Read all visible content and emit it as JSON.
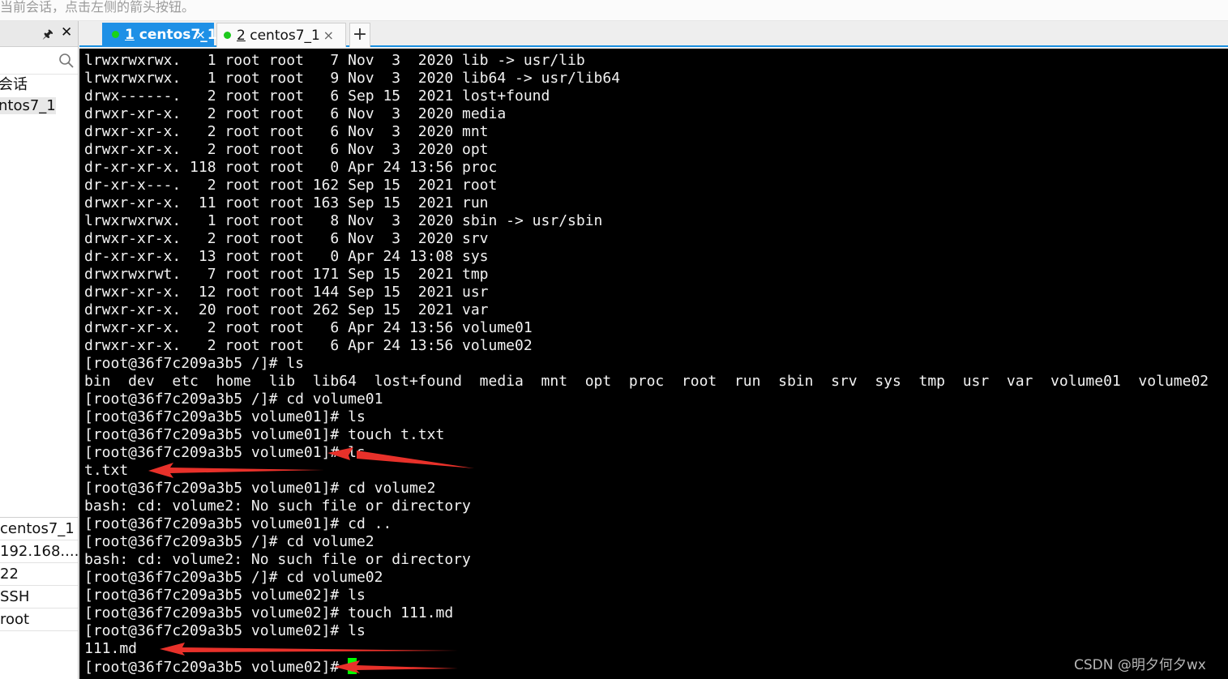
{
  "hint_text": "当前会话，点击左侧的箭头按钮。",
  "left_panel": {
    "pin_icon": "pin-icon",
    "close_icon": "close-icon",
    "search_icon": "search-icon",
    "tree_items": [
      "会话",
      "ntos7_1"
    ],
    "properties": [
      "centos7_1",
      "192.168....",
      "22",
      "SSH",
      "root"
    ]
  },
  "tabs": [
    {
      "number": "1",
      "label": "centos7_1",
      "status_color": "#19d319",
      "active": true,
      "close": "×"
    },
    {
      "number": "2",
      "label": "centos7_1",
      "status_color": "#1dc91d",
      "active": false,
      "close": "×"
    }
  ],
  "add_tab_label": "+",
  "terminal": {
    "lines": [
      "lrwxrwxrwx.   1 root root   7 Nov  3  2020 lib -> usr/lib",
      "lrwxrwxrwx.   1 root root   9 Nov  3  2020 lib64 -> usr/lib64",
      "drwx------.   2 root root   6 Sep 15  2021 lost+found",
      "drwxr-xr-x.   2 root root   6 Nov  3  2020 media",
      "drwxr-xr-x.   2 root root   6 Nov  3  2020 mnt",
      "drwxr-xr-x.   2 root root   6 Nov  3  2020 opt",
      "dr-xr-xr-x. 118 root root   0 Apr 24 13:56 proc",
      "dr-xr-x---.   2 root root 162 Sep 15  2021 root",
      "drwxr-xr-x.  11 root root 163 Sep 15  2021 run",
      "lrwxrwxrwx.   1 root root   8 Nov  3  2020 sbin -> usr/sbin",
      "drwxr-xr-x.   2 root root   6 Nov  3  2020 srv",
      "dr-xr-xr-x.  13 root root   0 Apr 24 13:08 sys",
      "drwxrwxrwt.   7 root root 171 Sep 15  2021 tmp",
      "drwxr-xr-x.  12 root root 144 Sep 15  2021 usr",
      "drwxr-xr-x.  20 root root 262 Sep 15  2021 var",
      "drwxr-xr-x.   2 root root   6 Apr 24 13:56 volume01",
      "drwxr-xr-x.   2 root root   6 Apr 24 13:56 volume02",
      "[root@36f7c209a3b5 /]# ls",
      "bin  dev  etc  home  lib  lib64  lost+found  media  mnt  opt  proc  root  run  sbin  srv  sys  tmp  usr  var  volume01  volume02",
      "[root@36f7c209a3b5 /]# cd volume01",
      "[root@36f7c209a3b5 volume01]# ls",
      "[root@36f7c209a3b5 volume01]# touch t.txt",
      "[root@36f7c209a3b5 volume01]# ls",
      "t.txt",
      "[root@36f7c209a3b5 volume01]# cd volume2",
      "bash: cd: volume2: No such file or directory",
      "[root@36f7c209a3b5 volume01]# cd ..",
      "[root@36f7c209a3b5 /]# cd volume2",
      "bash: cd: volume2: No such file or directory",
      "[root@36f7c209a3b5 /]# cd volume02",
      "[root@36f7c209a3b5 volume02]# ls",
      "[root@36f7c209a3b5 volume02]# touch 111.md",
      "[root@36f7c209a3b5 volume02]# ls",
      "111.md",
      "[root@36f7c209a3b5 volume02]# "
    ],
    "cursor_color": "#00ff00"
  },
  "annotation_arrow_color": "#e8312a",
  "watermark": "CSDN @明夕何夕wx"
}
